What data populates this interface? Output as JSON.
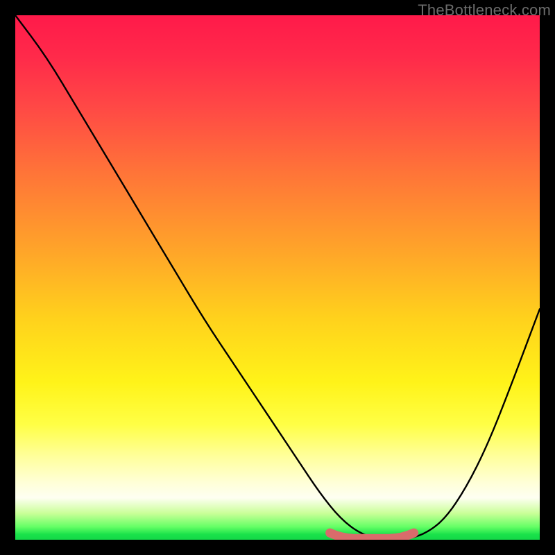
{
  "attribution": "TheBottleneck.com",
  "chart_data": {
    "type": "line",
    "title": "",
    "xlabel": "",
    "ylabel": "",
    "xlim": [
      0,
      100
    ],
    "ylim": [
      0,
      100
    ],
    "series": [
      {
        "name": "bottleneck-curve",
        "x": [
          0,
          6,
          12,
          18,
          24,
          30,
          36,
          42,
          48,
          54,
          58,
          62,
          66,
          70,
          74,
          78,
          82,
          86,
          90,
          94,
          100
        ],
        "y": [
          100,
          92,
          82,
          72,
          62,
          52,
          42,
          33,
          24,
          15,
          9,
          4,
          1,
          0,
          0,
          1,
          4,
          10,
          18,
          28,
          44
        ]
      }
    ],
    "highlight": {
      "name": "optimal-range",
      "color": "#d96b6b",
      "x_start": 60,
      "x_end": 76,
      "y": 0.5
    },
    "gradient_stops": [
      {
        "pos": 0.0,
        "color": "#ff1a4a"
      },
      {
        "pos": 0.45,
        "color": "#ffd21c"
      },
      {
        "pos": 0.8,
        "color": "#ffff9a"
      },
      {
        "pos": 0.97,
        "color": "#66ff66"
      },
      {
        "pos": 1.0,
        "color": "#14d848"
      }
    ]
  }
}
